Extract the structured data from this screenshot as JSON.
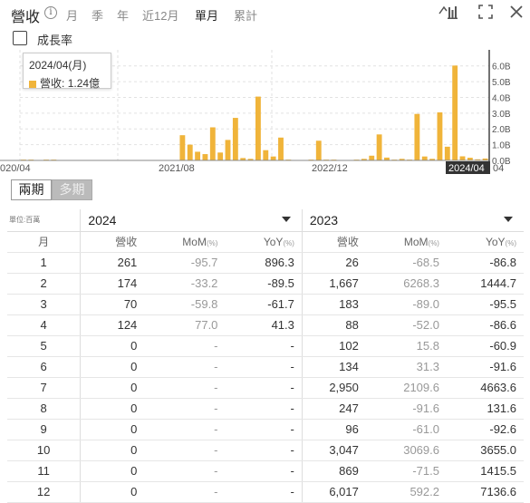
{
  "header": {
    "title": "營收",
    "info_icon": "i",
    "periods": [
      "月",
      "季",
      "年",
      "近12月",
      "單月",
      "累計"
    ],
    "active_period": "單月",
    "icons": [
      "chart-type-icon",
      "expand-icon",
      "close-icon"
    ]
  },
  "growth_rate": {
    "label": "成長率",
    "checked": false
  },
  "tooltip": {
    "title": "2024/04(月)",
    "series": "營收",
    "value": "1.24億"
  },
  "chart_data": {
    "type": "bar",
    "series": [
      {
        "color": "#f0b43a",
        "values": [
          0.05,
          0.05,
          0.02,
          0.05,
          0.05,
          0.02,
          0.02,
          0.02,
          0.02,
          0.02,
          0.02,
          0.02,
          0.02,
          0.02,
          0.02,
          0.02,
          0.02,
          0.02,
          0.02,
          0.02,
          0.02,
          1.6,
          1.0,
          0.55,
          0.4,
          2.1,
          0.5,
          1.3,
          2.7,
          0.15,
          0.1,
          4.05,
          0.65,
          0.25,
          1.45,
          0.05,
          0.02,
          0.02,
          0.05,
          1.25,
          0.05,
          0.05,
          0.02,
          0.02,
          0.05,
          0.1,
          0.3,
          1.65,
          0.18,
          0.05,
          0.1,
          0.05,
          2.95,
          0.25,
          0.1,
          3.05,
          0.87,
          6.02,
          0.26,
          0.17,
          0.07,
          0.12
        ]
      }
    ],
    "x_ticks": [
      "020/04",
      "2021/08",
      "2022/12",
      "2024/04"
    ],
    "x_edge_label": "04",
    "y_ticks": [
      "0.0B",
      "1.0B",
      "2.0B",
      "3.0B",
      "4.0B",
      "5.0B",
      "6.0B"
    ],
    "ylim": [
      0,
      6.5
    ],
    "highlight": "2024/04"
  },
  "toggle": {
    "two_periods": "兩期",
    "multi_periods": "多期",
    "active": "兩期"
  },
  "table": {
    "unit": "單位:百萬",
    "year_left": "2024",
    "year_right": "2023",
    "headers": {
      "month": "月",
      "revenue": "營收",
      "mom": "MoM",
      "yoy": "YoY",
      "pct": "(%)"
    },
    "rows": [
      {
        "m": "1",
        "r1": "261",
        "mom1": "-95.7",
        "yoy1": "896.3",
        "r2": "26",
        "mom2": "-68.5",
        "yoy2": "-86.8"
      },
      {
        "m": "2",
        "r1": "174",
        "mom1": "-33.2",
        "yoy1": "-89.5",
        "r2": "1,667",
        "mom2": "6268.3",
        "yoy2": "1444.7"
      },
      {
        "m": "3",
        "r1": "70",
        "mom1": "-59.8",
        "yoy1": "-61.7",
        "r2": "183",
        "mom2": "-89.0",
        "yoy2": "-95.5"
      },
      {
        "m": "4",
        "r1": "124",
        "mom1": "77.0",
        "yoy1": "41.3",
        "r2": "88",
        "mom2": "-52.0",
        "yoy2": "-86.6"
      },
      {
        "m": "5",
        "r1": "0",
        "mom1": "-",
        "yoy1": "-",
        "r2": "102",
        "mom2": "15.8",
        "yoy2": "-60.9"
      },
      {
        "m": "6",
        "r1": "0",
        "mom1": "-",
        "yoy1": "-",
        "r2": "134",
        "mom2": "31.3",
        "yoy2": "-91.6"
      },
      {
        "m": "7",
        "r1": "0",
        "mom1": "-",
        "yoy1": "-",
        "r2": "2,950",
        "mom2": "2109.6",
        "yoy2": "4663.6"
      },
      {
        "m": "8",
        "r1": "0",
        "mom1": "-",
        "yoy1": "-",
        "r2": "247",
        "mom2": "-91.6",
        "yoy2": "131.6"
      },
      {
        "m": "9",
        "r1": "0",
        "mom1": "-",
        "yoy1": "-",
        "r2": "96",
        "mom2": "-61.0",
        "yoy2": "-92.6"
      },
      {
        "m": "10",
        "r1": "0",
        "mom1": "-",
        "yoy1": "-",
        "r2": "3,047",
        "mom2": "3069.6",
        "yoy2": "3655.0"
      },
      {
        "m": "11",
        "r1": "0",
        "mom1": "-",
        "yoy1": "-",
        "r2": "869",
        "mom2": "-71.5",
        "yoy2": "1415.5"
      },
      {
        "m": "12",
        "r1": "0",
        "mom1": "-",
        "yoy1": "-",
        "r2": "6,017",
        "mom2": "592.2",
        "yoy2": "7136.6"
      }
    ]
  }
}
